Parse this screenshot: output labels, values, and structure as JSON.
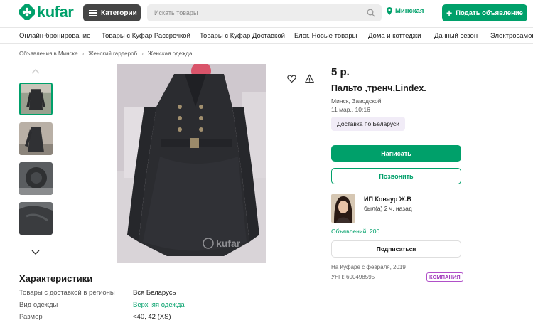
{
  "header": {
    "logo_text": "kufar",
    "categories_label": "Категории",
    "search_placeholder": "Искать товары",
    "city": "Минская",
    "post_ad_label": "Подать объявление",
    "accent_color": "#00a06a"
  },
  "nav": [
    "Онлайн-бронирование",
    "Товары с Куфар Рассрочкой",
    "Товары с Куфар Доставкой",
    "Блог. Новые товары",
    "Дома и коттеджи",
    "Дачный сезон",
    "Электросамок"
  ],
  "breadcrumbs": [
    "Объявления в Минске",
    "Женский гардероб",
    "Женская одежда"
  ],
  "listing": {
    "price": "5 р.",
    "title": "Пальто ,тренч,Lindex.",
    "location": "Минск, Заводской",
    "date": "11 мар., 10:16",
    "delivery_badge": "Доставка по Беларуси",
    "write_label": "Написать",
    "call_label": "Позвонить",
    "image_watermark": "kufar"
  },
  "seller": {
    "name": "ИП Ковчур Ж.В",
    "last_seen": "был(а) 2 ч. назад",
    "ads_count": "Объявлений: 200",
    "subscribe_label": "Подписаться",
    "since": "На Куфаре с февраля, 2019",
    "unp": "УНП: 600498595",
    "company_badge": "КОМПАНИЯ"
  },
  "characteristics": {
    "title": "Характеристики",
    "rows": [
      {
        "label": "Товары с доставкой в регионы",
        "value": "Вся Беларусь"
      },
      {
        "label": "Вид одежды",
        "value": "Верхняя одежда"
      },
      {
        "label": "Размер",
        "value": "<40, 42 (XS)"
      }
    ]
  }
}
